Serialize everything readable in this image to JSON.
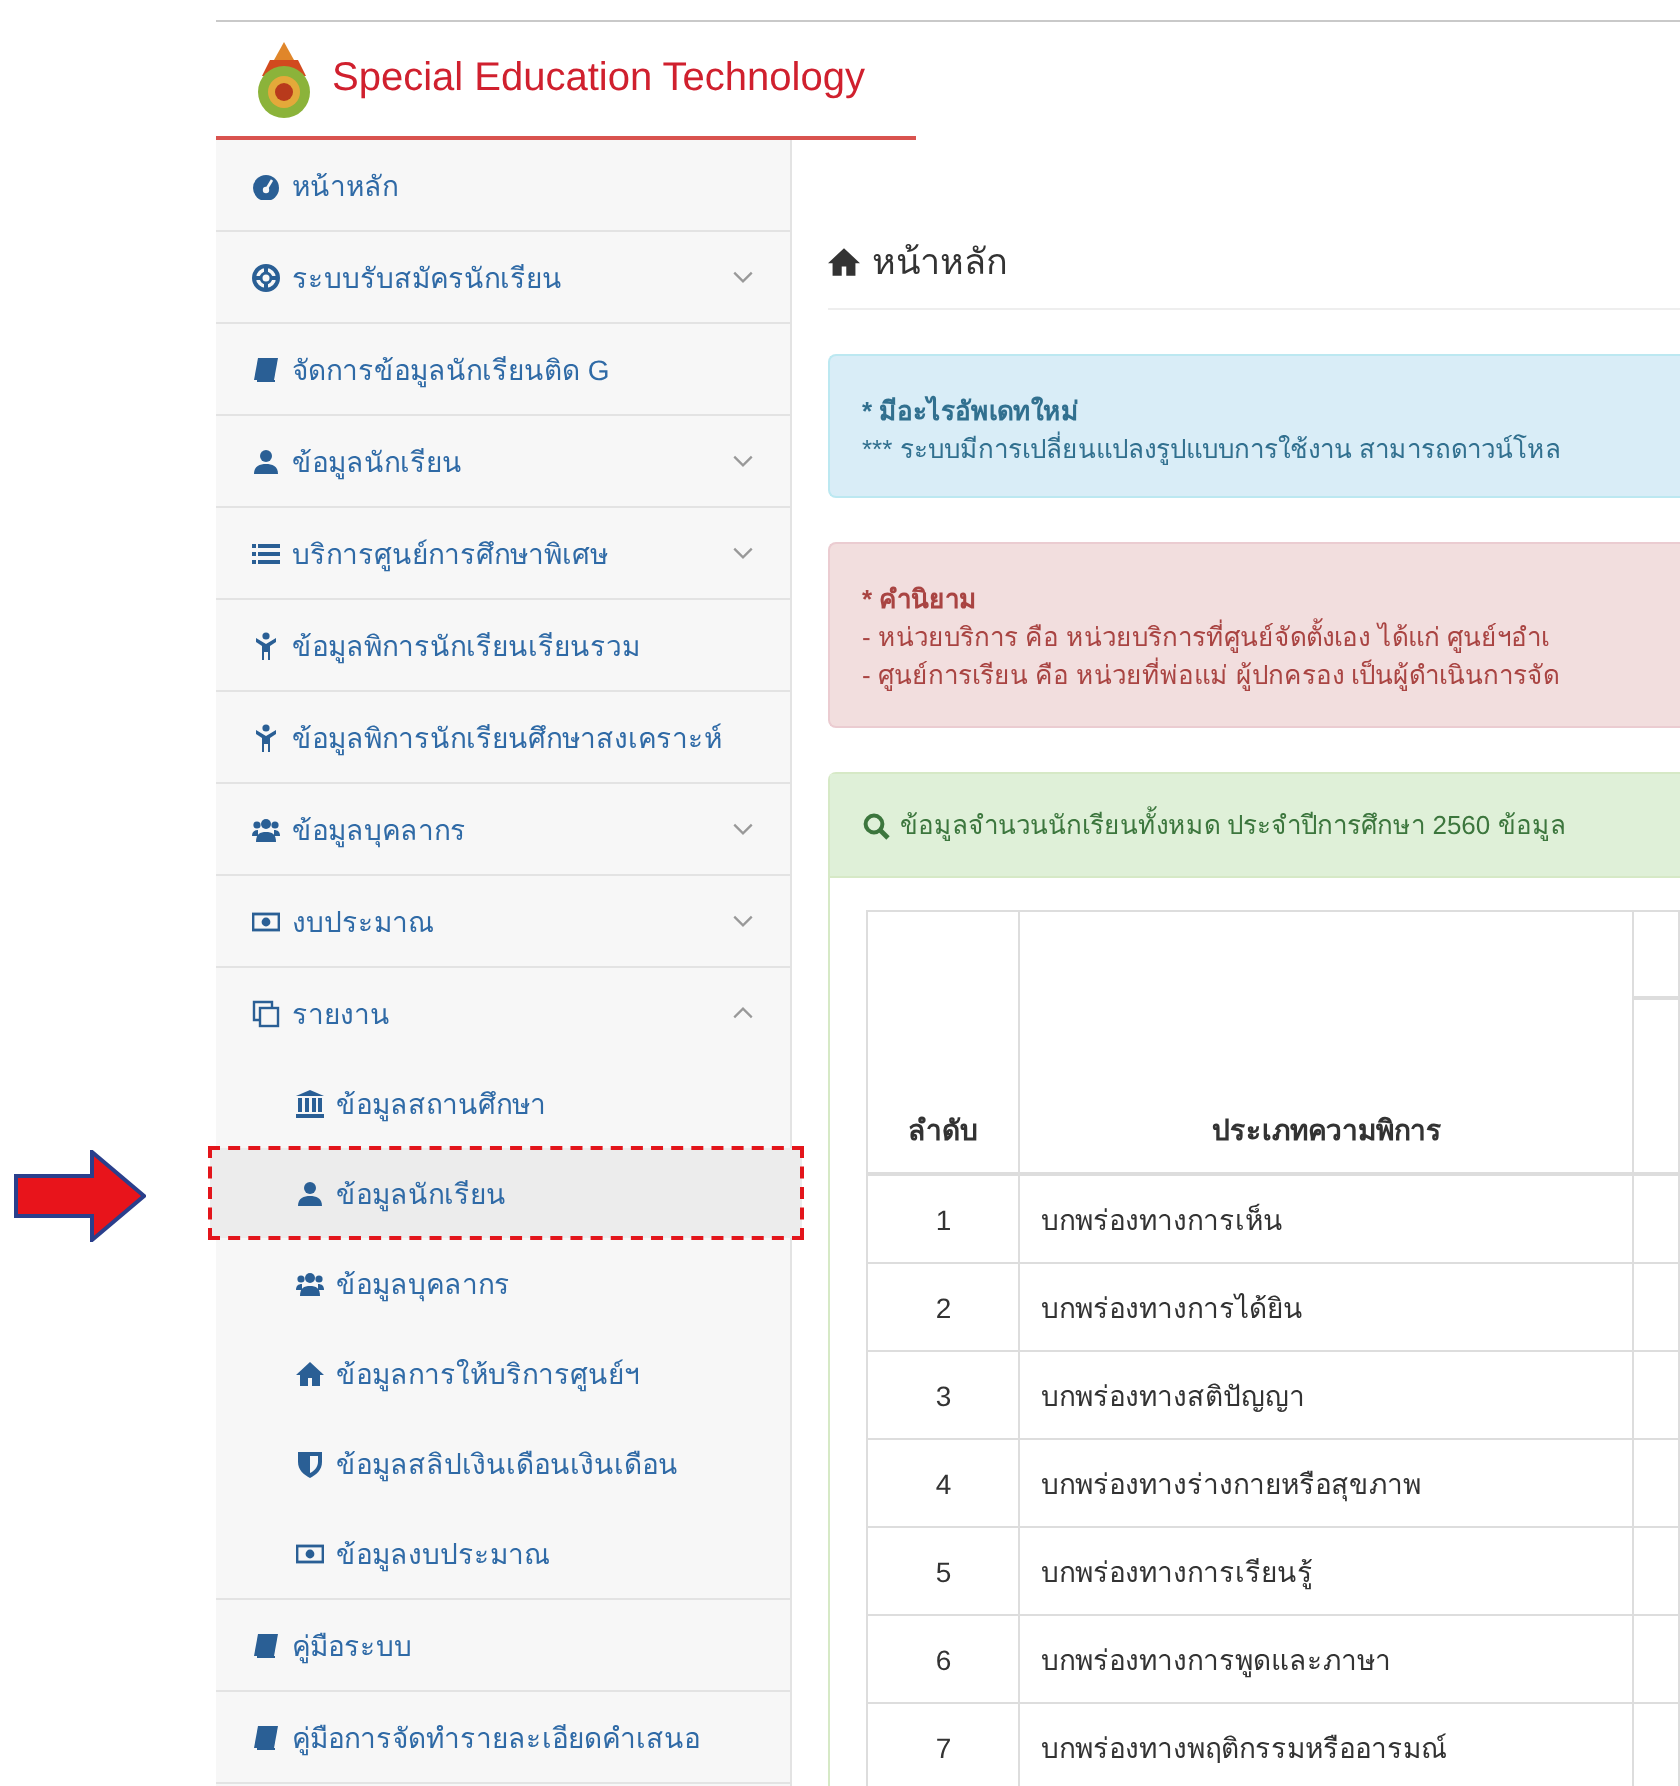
{
  "header": {
    "title": "Special Education Technology"
  },
  "sidebar": {
    "items": [
      {
        "label": "หน้าหลัก"
      },
      {
        "label": "ระบบรับสมัครนักเรียน",
        "expanded": false
      },
      {
        "label": "จัดการข้อมูลนักเรียนติด G"
      },
      {
        "label": "ข้อมูลนักเรียน",
        "expanded": false
      },
      {
        "label": "บริการศูนย์การศึกษาพิเศษ",
        "expanded": false
      },
      {
        "label": "ข้อมูลพิการนักเรียนเรียนรวม"
      },
      {
        "label": "ข้อมูลพิการนักเรียนศึกษาสงเคราะห์"
      },
      {
        "label": "ข้อมูลบุคลากร",
        "expanded": false
      },
      {
        "label": "งบประมาณ",
        "expanded": false
      },
      {
        "label": "รายงาน",
        "expanded": true,
        "children": [
          {
            "label": "ข้อมูลสถานศึกษา",
            "selected": false
          },
          {
            "label": "ข้อมูลนักเรียน",
            "selected": true
          },
          {
            "label": "ข้อมูลบุคลากร",
            "selected": false
          },
          {
            "label": "ข้อมูลการให้บริการศูนย์ฯ",
            "selected": false
          },
          {
            "label": "ข้อมูลสลิปเงินเดือนเงินเดือน",
            "selected": false
          },
          {
            "label": "ข้อมูลงบประมาณ",
            "selected": false
          }
        ]
      },
      {
        "label": "คู่มือระบบ"
      },
      {
        "label": "คู่มือการจัดทำรายละเอียดคำเสนอ"
      }
    ]
  },
  "main": {
    "page_title": "หน้าหลัก",
    "alerts": [
      {
        "kind": "info",
        "title": "* มีอะไรอัพเดทใหม่",
        "lines": [
          "*** ระบบมีการเปลี่ยนแปลงรูปแบบการใช้งาน สามารถดาวน์โหล"
        ]
      },
      {
        "kind": "danger",
        "title": "* คำนิยาม",
        "lines": [
          "- หน่วยบริการ คือ หน่วยบริการที่ศูนย์จัดตั้งเอง ได้แก่ ศูนย์ฯอำเ",
          "- ศูนย์การเรียน คือ หน่วยที่พ่อแม่ ผู้ปกครอง เป็นผู้ดำเนินการจัด"
        ]
      }
    ],
    "panel": {
      "heading": "ข้อมูลจำนวนนักเรียนทั้งหมด ประจำปีการศึกษา 2560 ข้อมูล",
      "table": {
        "columns": [
          "ลำดับ",
          "ประเภทความพิการ"
        ],
        "rows": [
          [
            "1",
            "บกพร่องทางการเห็น"
          ],
          [
            "2",
            "บกพร่องทางการได้ยิน"
          ],
          [
            "3",
            "บกพร่องทางสติปัญญา"
          ],
          [
            "4",
            "บกพร่องทางร่างกายหรือสุขภาพ"
          ],
          [
            "5",
            "บกพร่องทางการเรียนรู้"
          ],
          [
            "6",
            "บกพร่องทางการพูดและภาษา"
          ],
          [
            "7",
            "บกพร่องทางพฤติกรรมหรืออารมณ์"
          ]
        ]
      }
    }
  }
}
